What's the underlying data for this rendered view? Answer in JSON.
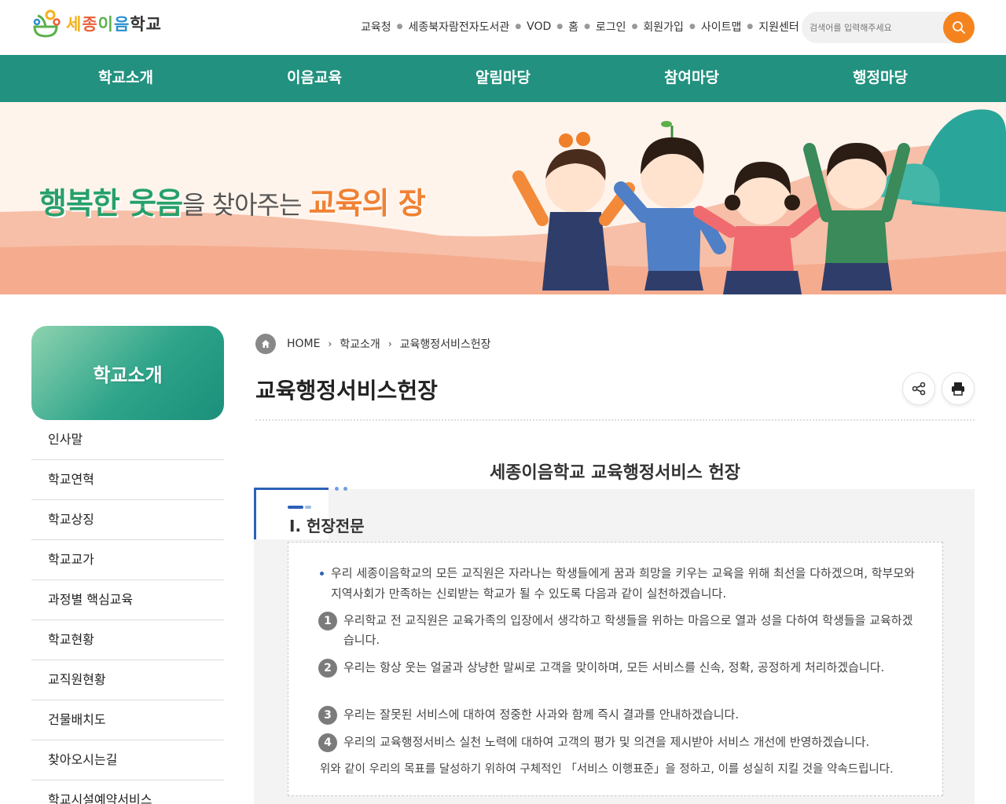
{
  "header": {
    "logo_text": [
      "세",
      "종",
      "이",
      "음",
      "학교"
    ],
    "util_links": [
      "교육청",
      "세종북자람전자도서관",
      "VOD",
      "홈",
      "로그인",
      "회원가입",
      "사이트맵",
      "지원센터"
    ],
    "search_placeholder": "검색어를 입력해주세요",
    "accent_color": "#f5841f"
  },
  "gnb": {
    "items": [
      "학교소개",
      "이음교육",
      "알림마당",
      "참여마당",
      "행정마당"
    ],
    "bg_color": "#22917f"
  },
  "banner": {
    "part1": "행복한 웃음",
    "part2": "을 찾아주는 ",
    "part3": "교육의 장"
  },
  "sidebar": {
    "title": "학교소개",
    "items": [
      "인사말",
      "학교연혁",
      "학교상징",
      "학교교가",
      "과정별 핵심교육",
      "학교현황",
      "교직원현황",
      "건물배치도",
      "찾아오시는길",
      "학교시설예약서비스"
    ]
  },
  "breadcrumb": {
    "home": "HOME",
    "level1": "학교소개",
    "level2": "교육행정서비스헌장"
  },
  "page": {
    "title": "교육행정서비스헌장",
    "share_icon": "share-icon",
    "print_icon": "print-icon"
  },
  "content": {
    "heading": "세종이음학교 교육행정서비스 헌장",
    "section_title": "Ⅰ. 헌장전문",
    "intro": "우리 세종이음학교의 모든 교직원은 자라나는 학생들에게 꿈과 희망을 키우는 교육을 위해 최선을 다하겠으며, 학부모와 지역사회가 만족하는 신뢰받는 학교가 될 수 있도록 다음과 같이 실천하겠습니다.",
    "items": [
      {
        "num": "1",
        "text": "우리학교 전 교직원은 교육가족의 입장에서 생각하고 학생들을 위하는 마음으로 열과 성을 다하여 학생들을 교육하겠습니다."
      },
      {
        "num": "2",
        "text": "우리는 항상 웃는 얼굴과 상냥한 말씨로 고객을 맞이하며, 모든 서비스를 신속, 정확, 공정하게 처리하겠습니다."
      },
      {
        "num": "3",
        "text": "우리는 잘못된 서비스에 대하여 정중한 사과와 함께 즉시 결과를 안내하겠습니다."
      },
      {
        "num": "4",
        "text": "우리의 교육행정서비스 실천 노력에 대하여 고객의 평가 및 의견을 제시받아 서비스 개선에 반영하겠습니다."
      }
    ],
    "closing": "위와 같이 우리의 목표를 달성하기 위하여 구체적인 「서비스 이행표준」을 정하고, 이를 성실히 지킬 것을 약속드립니다."
  }
}
